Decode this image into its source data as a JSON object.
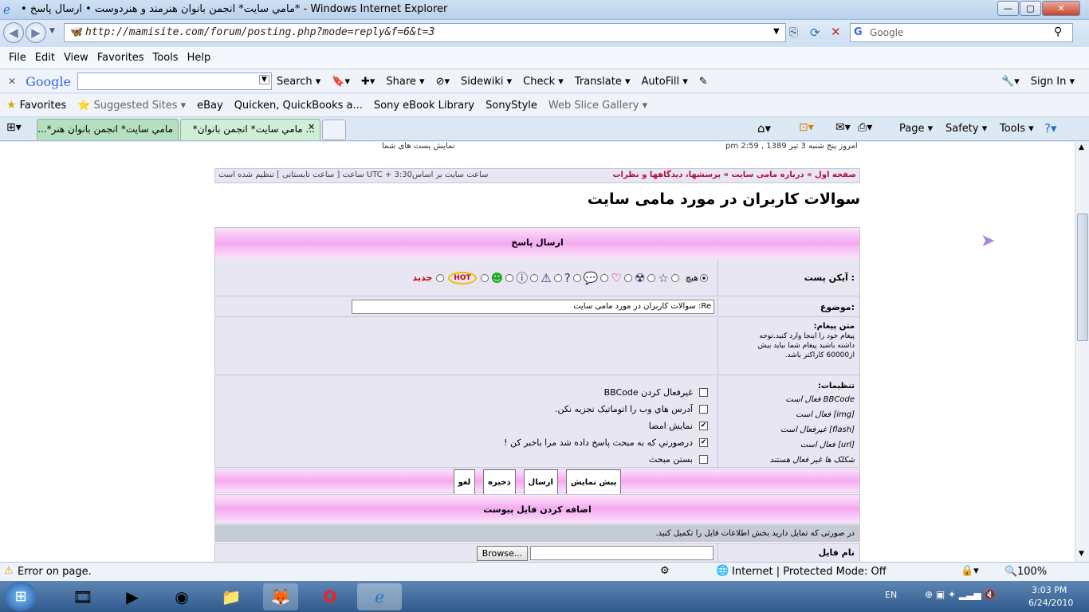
{
  "window": {
    "title": "• مامي سايت* انجمن بانوان هنرمند و هنردوست • ارسال پاسخ* - Windows Internet Explorer",
    "btn_min": "—",
    "btn_max": "▢",
    "btn_close": "✕"
  },
  "address_bar": {
    "url": "http://mamisite.com/forum/posting.php?mode=reply&f=6&t=3",
    "search_placeholder": "Google"
  },
  "menu": [
    "File",
    "Edit",
    "View",
    "Favorites",
    "Tools",
    "Help"
  ],
  "google_toolbar": {
    "logo": "Google",
    "items": [
      "Search ▾",
      "Share ▾",
      "Sidewiki ▾",
      "Check ▾",
      "Translate ▾",
      "AutoFill ▾"
    ],
    "right": [
      "Sign In ▾"
    ]
  },
  "favorites_bar": {
    "label": "Favorites",
    "items": [
      "Suggested Sites ▾",
      "eBay",
      "Quicken, QuickBooks a...",
      "Sony eBook Library",
      "SonyStyle",
      "Web Slice Gallery ▾"
    ]
  },
  "tabs": [
    {
      "label": "مامي سايت* انجمن بانوان هنر*..."
    },
    {
      "label": "... مامي سايت* انجمن بانوان*"
    }
  ],
  "command_bar": [
    "Page ▾",
    "Safety ▾",
    "Tools ▾"
  ],
  "page": {
    "top_left": "نمایش پست های شما",
    "top_right": "امروز پنج شنبه 3 تیر 1389 , 2:59 pm",
    "breadcrumb": "صفحه اول » درباره مامی سایت » پرسشها، دیدگاهها و نظرات",
    "timezone": "ساعت سایت بر اساس3:30 + UTC ساعت [ ساعت تابستانی ] تنظیم شده است",
    "heading": "سوالات کاربران در مورد مامی سایت",
    "reply_header": "ارسال پاسخ",
    "icon_label": "آیکن پست :",
    "icon_none": "هیچ",
    "hot_badge": "HOT",
    "new_badge": "جديد",
    "subject_label": "موضوع:",
    "subject_value": "Re: سوالات کاربران در مورد مامی سایت",
    "message_label": "متن پیغام:",
    "message_help_1": "پیغام خود را اینجا وارد کنید.توجه",
    "message_help_2": "داشته باشید پیغام شما نباید بیش",
    "message_help_3": "از60000 کاراکتر باشد.",
    "settings_label": "تنظیمات:",
    "settings_info": [
      "BBCode فعال است",
      "[img] فعال است",
      "[flash] غیرفعال است",
      "[url] فعال است",
      "شکلک ها غیر فعال هستند"
    ],
    "options": [
      {
        "label": "غیرفعال کردن BBCode",
        "checked": false
      },
      {
        "label": "آدرس هاي وب را اتوماتیک تجزیه نکن.",
        "checked": false
      },
      {
        "label": "نمایش امضا",
        "checked": true
      },
      {
        "label": "درصورتي که به مبحث پاسخ داده شد مرا باخبر کن !",
        "checked": true
      },
      {
        "label": "بستن مبحث",
        "checked": false
      }
    ],
    "buttons": {
      "preview": "پیش نمایش",
      "submit": "ارسال",
      "save": "ذخیره",
      "cancel": "لغو"
    },
    "attach_header": "اضافه کردن فایل پیوست",
    "attach_note": "در صورتی که تمایل دارید بخش اطلاعات فایل را تکمیل کنید.",
    "file_label": "نام فایل",
    "browse": "Browse..."
  },
  "status_bar": {
    "error": "Error on page.",
    "zone": "Internet | Protected Mode: Off",
    "zoom": "100%"
  },
  "taskbar": {
    "lang": "EN",
    "time": "3:03 PM",
    "date": "6/24/2010"
  }
}
